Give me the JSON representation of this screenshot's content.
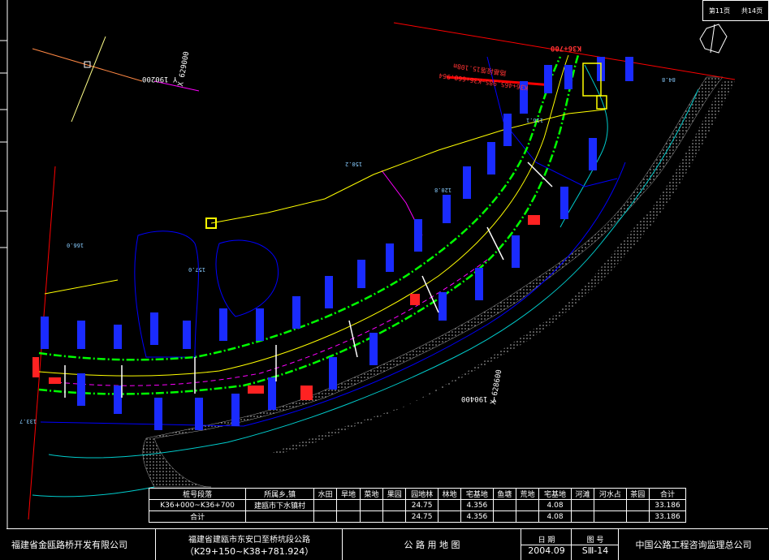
{
  "sheet": {
    "sheet_no": "第11页",
    "total": "共14页"
  },
  "map_labels": {
    "coord_top_left": "X 629000",
    "coord_top_left_y": "Y 190200",
    "coord_bottom_right": "X 628600",
    "coord_bottom_right_y": "Y 190400",
    "station_start": "K36+700",
    "station_note_1": "K36+465.985~K36+660.964",
    "station_note_2": "路基段落15.108m",
    "elev_1": "150.2",
    "elev_2": "157.0",
    "elev_3": "166.0",
    "elev_4": "120.8",
    "elev_5": "116.1",
    "elev_6": "84.8",
    "elev_7": "133.7"
  },
  "summary_table": {
    "headers": [
      "桩号段落",
      "所属乡,镇",
      "水田",
      "旱地",
      "菜地",
      "果园",
      "园地林",
      "林地",
      "宅基地",
      "鱼塘",
      "荒地",
      "宅基地",
      "河滩",
      "河水占",
      "茶园",
      "合计"
    ],
    "row1": [
      "K36+000~K36+700",
      "建瓯市下水镇村",
      "",
      "",
      "",
      "",
      "24.75",
      "",
      "4.356",
      "",
      "",
      "4.08",
      "",
      "",
      "",
      "33.186"
    ],
    "row2": [
      "合计",
      "",
      "",
      "",
      "",
      "",
      "24.75",
      "",
      "4.356",
      "",
      "",
      "4.08",
      "",
      "",
      "",
      "33.186"
    ]
  },
  "title_block": {
    "company_left": "福建省金瓯路桥开发有限公司",
    "project_name": "福建省建瓯市东安口至桥坑段公路",
    "project_range": "（K29+150~K38+781.924）",
    "drawing_title": "公 路 用 地 图",
    "date_label": "日 期",
    "date_value": "2004.09",
    "drawing_no_label": "图 号",
    "drawing_no_value": "SⅢ-14",
    "company_right": "中国公路工程咨询监理总公司"
  },
  "colors": {
    "road": "#00ff00",
    "parcel": "#0000ff",
    "water": "#00cccc",
    "boundary": "#ff0000",
    "survey": "#ffff00",
    "magenta": "#ff00ff"
  }
}
